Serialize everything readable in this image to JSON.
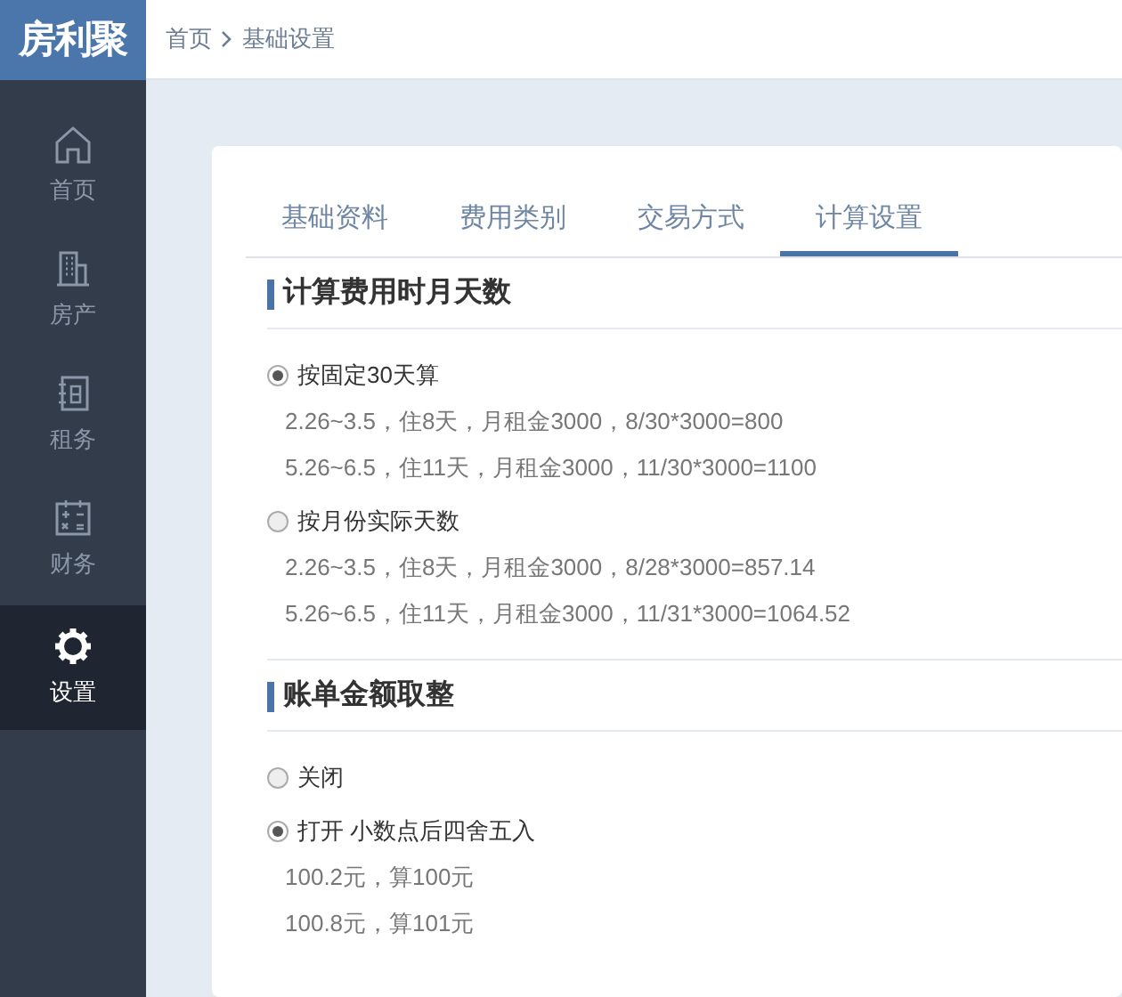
{
  "logo": "房利聚",
  "breadcrumb": [
    "首页",
    "基础设置"
  ],
  "sidebar": {
    "items": [
      {
        "label": "首页",
        "selected": false
      },
      {
        "label": "房产",
        "selected": false
      },
      {
        "label": "租务",
        "selected": false
      },
      {
        "label": "财务",
        "selected": false
      },
      {
        "label": "设置",
        "selected": true
      }
    ]
  },
  "tabs": [
    {
      "label": "基础资料",
      "selected": false
    },
    {
      "label": "费用类别",
      "selected": false
    },
    {
      "label": "交易方式",
      "selected": false
    },
    {
      "label": "计算设置",
      "selected": true
    }
  ],
  "sections": [
    {
      "heading": "计算费用时月天数",
      "options": [
        {
          "label": "按固定30天算",
          "selected": true,
          "lines": [
            "2.26~3.5，住8天，月租金3000，8/30*3000=800",
            "5.26~6.5，住11天，月租金3000，11/30*3000=1100"
          ]
        },
        {
          "label": "按月份实际天数",
          "selected": false,
          "lines": [
            "2.26~3.5，住8天，月租金3000，8/28*3000=857.14",
            "5.26~6.5，住11天，月租金3000，11/31*3000=1064.52"
          ]
        }
      ]
    },
    {
      "heading": "账单金额取整",
      "options": [
        {
          "label": "关闭",
          "selected": false
        },
        {
          "label": "打开 小数点后四舍五入",
          "selected": true,
          "lines": [
            "100.2元，算100元",
            "100.8元，算101元"
          ]
        }
      ]
    }
  ]
}
